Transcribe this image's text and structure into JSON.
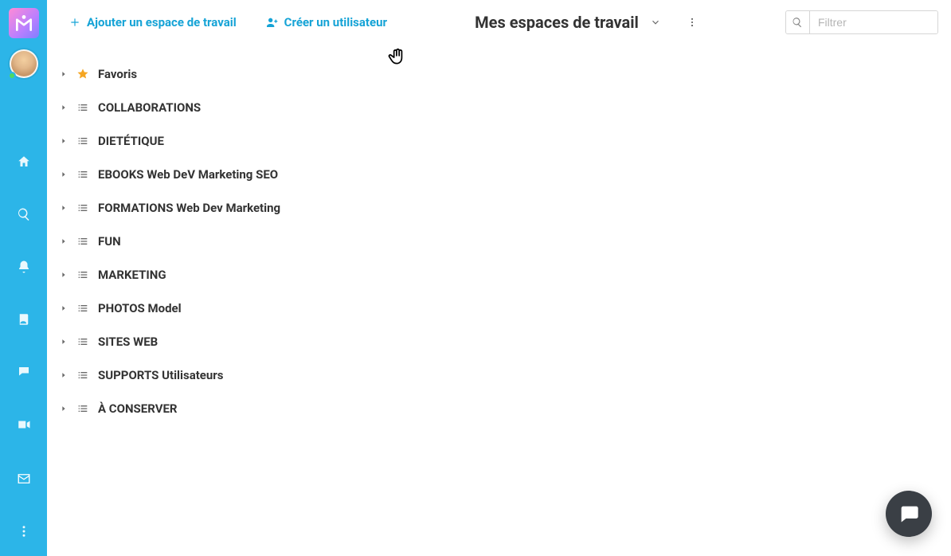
{
  "colors": {
    "accent": "#15a3d6",
    "sidebar_bg": "#2cb5e8",
    "star": "#f5a623",
    "fab_bg": "#3a3f45"
  },
  "sidebar": {
    "logo_label": "M",
    "nav_icons": [
      "home",
      "search",
      "bell",
      "contacts",
      "chat",
      "video"
    ],
    "bottom_icons": [
      "mail",
      "more"
    ]
  },
  "topbar": {
    "add_workspace_label": "Ajouter un espace de travail",
    "create_user_label": "Créer un utilisateur",
    "title": "Mes espaces de travail",
    "filter_placeholder": "Filtrer",
    "filter_value": ""
  },
  "tree": {
    "items": [
      {
        "label": "Favoris",
        "icon": "star"
      },
      {
        "label": "COLLABORATIONS",
        "icon": "list"
      },
      {
        "label": "DIETÉTIQUE",
        "icon": "list"
      },
      {
        "label": "EBOOKS Web DeV Marketing SEO",
        "icon": "list"
      },
      {
        "label": "FORMATIONS Web Dev Marketing",
        "icon": "list"
      },
      {
        "label": "FUN",
        "icon": "list"
      },
      {
        "label": "MARKETING",
        "icon": "list"
      },
      {
        "label": "PHOTOS Model",
        "icon": "list"
      },
      {
        "label": "SITES WEB",
        "icon": "list"
      },
      {
        "label": "SUPPORTS Utilisateurs",
        "icon": "list"
      },
      {
        "label": "À CONSERVER",
        "icon": "list"
      }
    ]
  }
}
